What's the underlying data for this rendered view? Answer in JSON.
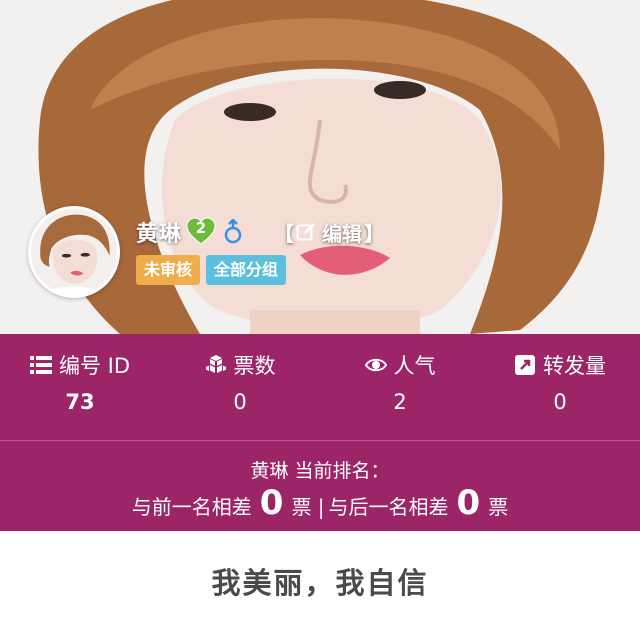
{
  "profile": {
    "name": "黄琳",
    "level": "2",
    "gender_icon": "male-icon",
    "edit": {
      "bracket_open": "【",
      "label": "编辑",
      "bracket_close": "】",
      "icon": "edit-icon"
    },
    "tags": {
      "status": "未审核",
      "group": "全部分组"
    }
  },
  "stats": {
    "id": {
      "label": "编号 ID",
      "value": "73",
      "icon": "list-icon"
    },
    "votes": {
      "label": "票数",
      "value": "0",
      "icon": "cubes-icon"
    },
    "popularity": {
      "label": "人气",
      "value": "2",
      "icon": "eye-icon"
    },
    "shares": {
      "label": "转发量",
      "value": "0",
      "icon": "share-icon"
    }
  },
  "ranking": {
    "title": "黄琳 当前排名：",
    "prev_prefix": "与前一名相差",
    "prev_diff": "0",
    "prev_unit": "票 |",
    "next_prefix": "与后一名相差",
    "next_diff": "0",
    "next_unit": "票"
  },
  "slogan": "我美丽，我自信",
  "colors": {
    "panel": "#9b2567",
    "tag_status": "#f0ad4e",
    "tag_group": "#5bc0de",
    "level_badge": "#6cbb3c",
    "gender": "#3a8ee6"
  }
}
